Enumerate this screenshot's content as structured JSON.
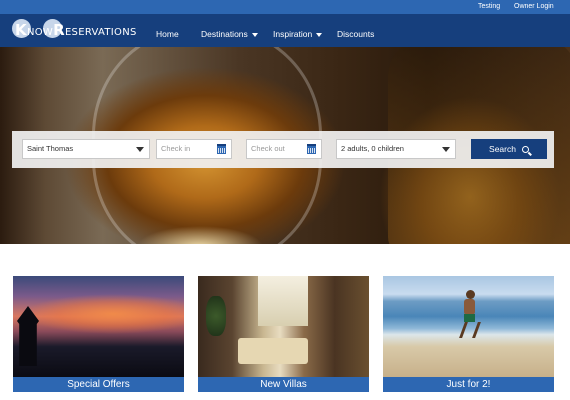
{
  "top_bar": {
    "links": [
      "Testing",
      "Owner Login"
    ],
    "background": "#2d67b2"
  },
  "brand": {
    "logo_text_k": "K",
    "logo_text_now": "NOW",
    "logo_text_r": "R",
    "logo_text_eservations": "ESERVATIONS"
  },
  "nav": {
    "background": "#163f7d",
    "items": [
      {
        "label": "Home",
        "has_dropdown": false
      },
      {
        "label": "Destinations",
        "has_dropdown": true
      },
      {
        "label": "Inspiration",
        "has_dropdown": true
      },
      {
        "label": "Discounts",
        "has_dropdown": false
      }
    ]
  },
  "search": {
    "destination_value": "Saint Thomas",
    "checkin_placeholder": "Check in",
    "checkout_placeholder": "Check out",
    "guests_value": "2 adults, 0 children",
    "button_label": "Search"
  },
  "cards": [
    {
      "label": "Special Offers"
    },
    {
      "label": "New Villas"
    },
    {
      "label": "Just for 2!"
    }
  ],
  "colors": {
    "accent": "#2d67b2",
    "brand_dark": "#163f7d"
  },
  "icons": {
    "calendar": "calendar-icon",
    "search": "search-icon",
    "dropdown": "chevron-down-icon"
  }
}
